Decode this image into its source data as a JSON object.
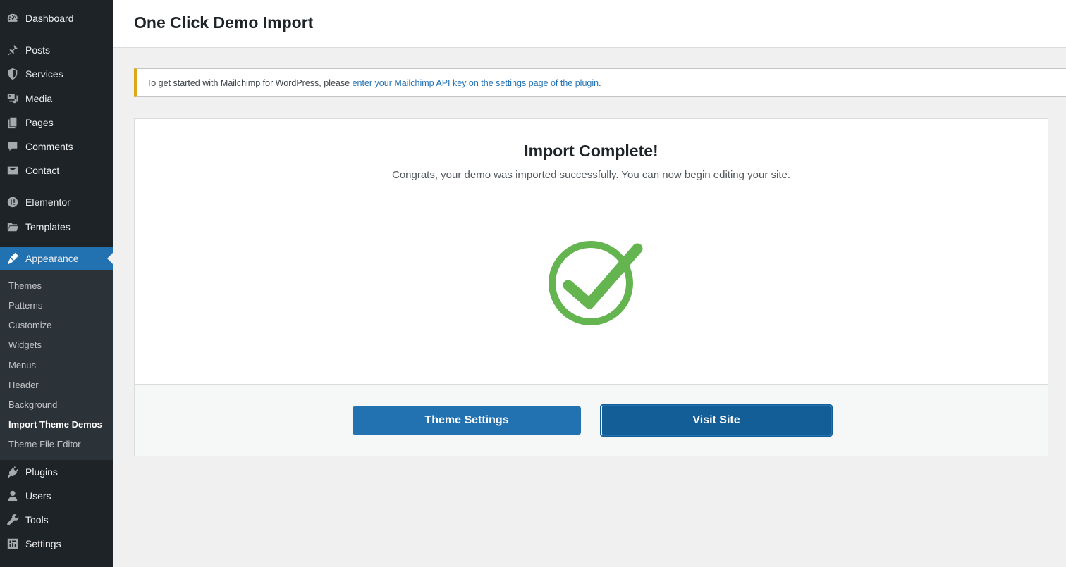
{
  "sidebar": {
    "items": [
      {
        "label": "Dashboard",
        "icon": "dashboard-icon"
      },
      {
        "label": "Posts",
        "icon": "pin-icon"
      },
      {
        "label": "Services",
        "icon": "shield-icon"
      },
      {
        "label": "Media",
        "icon": "media-icon"
      },
      {
        "label": "Pages",
        "icon": "pages-icon"
      },
      {
        "label": "Comments",
        "icon": "comment-icon"
      },
      {
        "label": "Contact",
        "icon": "mail-icon"
      },
      {
        "label": "Elementor",
        "icon": "elementor-icon"
      },
      {
        "label": "Templates",
        "icon": "folder-icon"
      },
      {
        "label": "Appearance",
        "icon": "brush-icon"
      },
      {
        "label": "Plugins",
        "icon": "plug-icon"
      },
      {
        "label": "Users",
        "icon": "user-icon"
      },
      {
        "label": "Tools",
        "icon": "wrench-icon"
      },
      {
        "label": "Settings",
        "icon": "settings-icon"
      }
    ],
    "submenu": [
      {
        "label": "Themes"
      },
      {
        "label": "Patterns"
      },
      {
        "label": "Customize"
      },
      {
        "label": "Widgets"
      },
      {
        "label": "Menus"
      },
      {
        "label": "Header"
      },
      {
        "label": "Background"
      },
      {
        "label": "Import Theme Demos"
      },
      {
        "label": "Theme File Editor"
      }
    ]
  },
  "header": {
    "title": "One Click Demo Import"
  },
  "notice": {
    "text": "To get started with Mailchimp for WordPress, please ",
    "link": "enter your Mailchimp API key on the settings page of the plugin",
    "suffix": "."
  },
  "main": {
    "title": "Import Complete!",
    "subtitle": "Congrats, your demo was imported successfully. You can now begin editing your site.",
    "success_icon": "check-circle-icon",
    "success_color": "#64b450",
    "buttons": {
      "theme_settings": "Theme Settings",
      "visit_site": "Visit Site"
    }
  },
  "colors": {
    "accent": "#2271b1",
    "sidebar_bg": "#1d2327",
    "notice_border": "#dba617"
  }
}
